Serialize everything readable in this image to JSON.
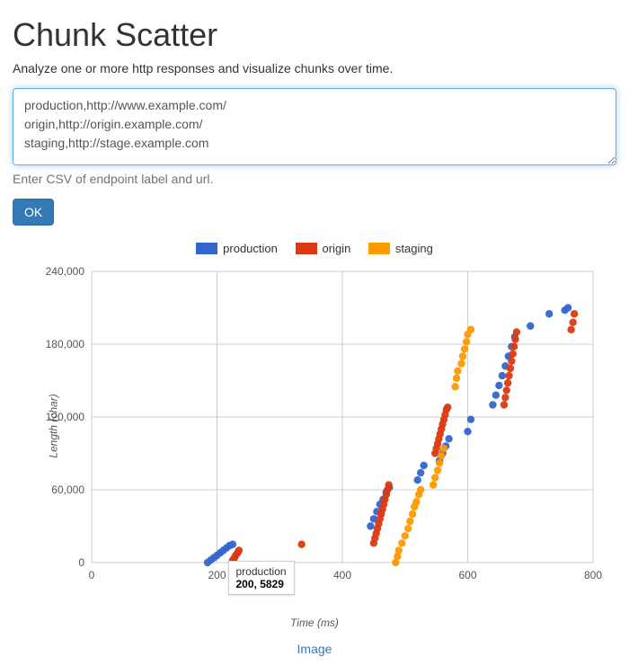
{
  "title": "Chunk Scatter",
  "lead": "Analyze one or more http responses and visualize chunks over time.",
  "textarea_value": "production,http://www.example.com/\norigin,http://origin.example.com/\nstaging,http://stage.example.com",
  "help_text": "Enter CSV of endpoint label and url.",
  "ok_label": "OK",
  "image_link_label": "Image",
  "tooltip": {
    "series": "production",
    "value": "200, 5829",
    "pos_x": 200,
    "pos_y": 5829
  },
  "chart_data": {
    "type": "scatter",
    "title": "",
    "xlabel": "Time (ms)",
    "ylabel": "Length (char)",
    "xlim": [
      0,
      800
    ],
    "ylim": [
      0,
      240000
    ],
    "xticks": [
      0,
      200,
      400,
      600,
      800
    ],
    "yticks": [
      0,
      60000,
      120000,
      180000,
      240000
    ],
    "ytick_labels": [
      "0",
      "60,000",
      "120,000",
      "180,000",
      "240,000"
    ],
    "legend_position": "top",
    "colors": {
      "production": "#3366cc",
      "origin": "#dc3912",
      "staging": "#ff9900"
    },
    "series": [
      {
        "name": "production",
        "points": [
          [
            185,
            0
          ],
          [
            190,
            2000
          ],
          [
            195,
            4000
          ],
          [
            200,
            5829
          ],
          [
            205,
            8000
          ],
          [
            210,
            10000
          ],
          [
            215,
            12000
          ],
          [
            220,
            14000
          ],
          [
            225,
            15000
          ],
          [
            445,
            30000
          ],
          [
            450,
            36000
          ],
          [
            455,
            42000
          ],
          [
            460,
            48000
          ],
          [
            465,
            52000
          ],
          [
            470,
            58000
          ],
          [
            475,
            62000
          ],
          [
            520,
            68000
          ],
          [
            525,
            74000
          ],
          [
            530,
            80000
          ],
          [
            555,
            84000
          ],
          [
            560,
            90000
          ],
          [
            565,
            96000
          ],
          [
            570,
            102000
          ],
          [
            600,
            108000
          ],
          [
            605,
            118000
          ],
          [
            640,
            130000
          ],
          [
            645,
            138000
          ],
          [
            650,
            146000
          ],
          [
            655,
            154000
          ],
          [
            660,
            162000
          ],
          [
            665,
            170000
          ],
          [
            670,
            178000
          ],
          [
            675,
            186000
          ],
          [
            700,
            195000
          ],
          [
            730,
            205000
          ],
          [
            755,
            208000
          ],
          [
            760,
            210000
          ]
        ]
      },
      {
        "name": "origin",
        "points": [
          [
            225,
            2000
          ],
          [
            228,
            4000
          ],
          [
            230,
            6000
          ],
          [
            233,
            8000
          ],
          [
            235,
            10000
          ],
          [
            335,
            15000
          ],
          [
            450,
            16000
          ],
          [
            452,
            20000
          ],
          [
            454,
            24000
          ],
          [
            456,
            28000
          ],
          [
            458,
            32000
          ],
          [
            460,
            36000
          ],
          [
            462,
            40000
          ],
          [
            464,
            44000
          ],
          [
            466,
            48000
          ],
          [
            468,
            52000
          ],
          [
            470,
            56000
          ],
          [
            472,
            60000
          ],
          [
            474,
            64000
          ],
          [
            548,
            90000
          ],
          [
            550,
            94000
          ],
          [
            552,
            98000
          ],
          [
            554,
            102000
          ],
          [
            556,
            106000
          ],
          [
            558,
            110000
          ],
          [
            560,
            114000
          ],
          [
            562,
            118000
          ],
          [
            564,
            122000
          ],
          [
            566,
            126000
          ],
          [
            568,
            128000
          ],
          [
            658,
            130000
          ],
          [
            660,
            136000
          ],
          [
            662,
            142000
          ],
          [
            664,
            148000
          ],
          [
            666,
            154000
          ],
          [
            668,
            160000
          ],
          [
            670,
            166000
          ],
          [
            672,
            172000
          ],
          [
            674,
            178000
          ],
          [
            676,
            184000
          ],
          [
            678,
            190000
          ],
          [
            765,
            192000
          ],
          [
            768,
            198000
          ],
          [
            770,
            205000
          ]
        ]
      },
      {
        "name": "staging",
        "points": [
          [
            485,
            0
          ],
          [
            488,
            5000
          ],
          [
            490,
            10000
          ],
          [
            495,
            16000
          ],
          [
            500,
            22000
          ],
          [
            505,
            28000
          ],
          [
            508,
            34000
          ],
          [
            512,
            40000
          ],
          [
            515,
            46000
          ],
          [
            518,
            50000
          ],
          [
            522,
            56000
          ],
          [
            525,
            60000
          ],
          [
            545,
            64000
          ],
          [
            548,
            70000
          ],
          [
            552,
            76000
          ],
          [
            555,
            82000
          ],
          [
            558,
            88000
          ],
          [
            562,
            94000
          ],
          [
            580,
            145000
          ],
          [
            582,
            152000
          ],
          [
            584,
            158000
          ],
          [
            590,
            164000
          ],
          [
            592,
            170000
          ],
          [
            595,
            176000
          ],
          [
            598,
            182000
          ],
          [
            600,
            188000
          ],
          [
            605,
            192000
          ]
        ]
      }
    ]
  }
}
